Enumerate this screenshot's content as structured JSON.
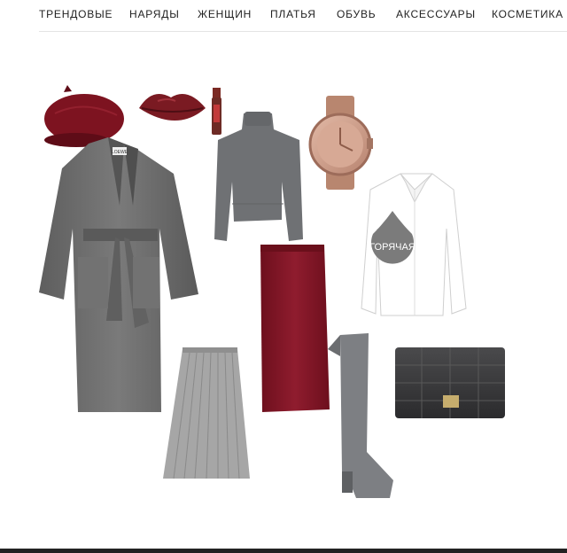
{
  "nav": {
    "items": [
      {
        "label": "ТРЕНДОВЫЕ"
      },
      {
        "label": "НАРЯДЫ"
      },
      {
        "label": "ЖЕНЩИН"
      },
      {
        "label": "ПЛАТЬЯ"
      },
      {
        "label": "ОБУВЬ"
      },
      {
        "label": "АКСЕССУАРЫ"
      },
      {
        "label": "КОСМЕТИКА"
      }
    ]
  },
  "collage": {
    "badge_label": "ГОРЯЧАЯ",
    "coat_tag": "LOEWE",
    "items": [
      {
        "icon": "beret-icon",
        "color": "#7d1320"
      },
      {
        "icon": "lips-icon",
        "color": "#7a1a22"
      },
      {
        "icon": "lipstick-icon",
        "color": "#6e2b25"
      },
      {
        "icon": "coat-icon",
        "color": "#6f6f6f"
      },
      {
        "icon": "sweater-icon",
        "color": "#6f7174"
      },
      {
        "icon": "watch-icon",
        "color": "#c99883"
      },
      {
        "icon": "shirt-icon",
        "color": "#ffffff"
      },
      {
        "icon": "pencil-skirt-icon",
        "color": "#84182a"
      },
      {
        "icon": "pleated-skirt-icon",
        "color": "#a6a6a6"
      },
      {
        "icon": "boot-icon",
        "color": "#7d7f83"
      },
      {
        "icon": "handbag-icon",
        "color": "#3a3a3c"
      }
    ]
  }
}
